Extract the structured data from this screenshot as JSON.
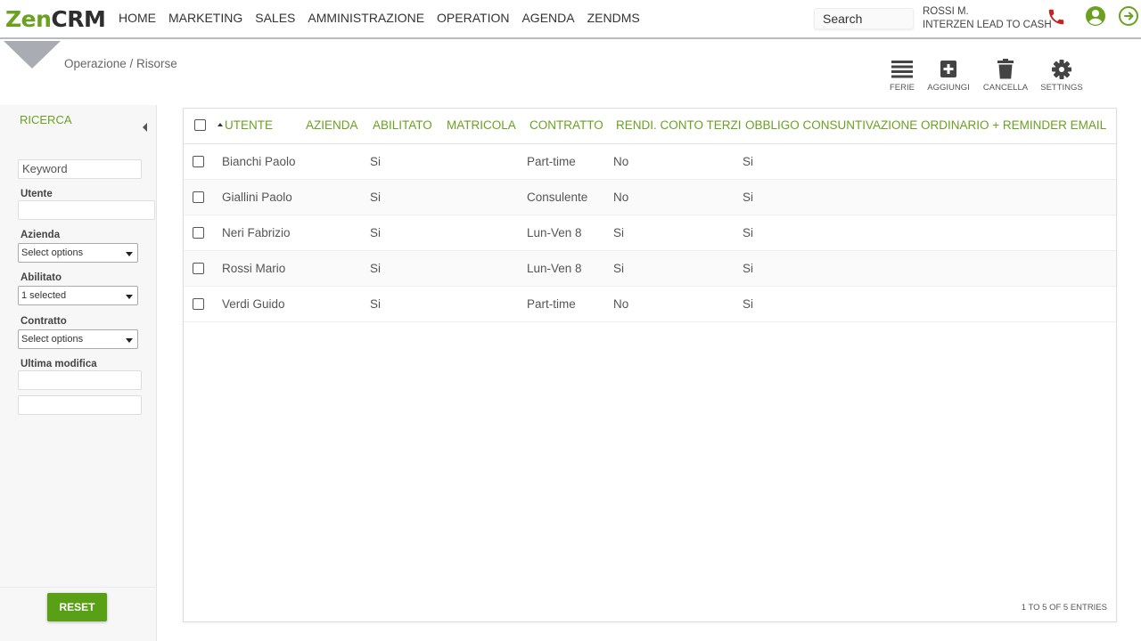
{
  "brand": {
    "part1": "Zen",
    "part2": "CRM"
  },
  "nav": [
    "HOME",
    "MARKETING",
    "SALES",
    "AMMINISTRAZIONE",
    "OPERATION",
    "AGENDA",
    "ZENDMS"
  ],
  "search": {
    "label": "Search"
  },
  "user": {
    "name": "ROSSI M.",
    "company": "INTERZEN LEAD TO CASH"
  },
  "icons": {
    "phone": "phone-icon",
    "user": "user-icon",
    "logout": "logout-icon"
  },
  "colors": {
    "accent": "#6aa121",
    "button": "#5aa016",
    "phone": "#c0261f"
  },
  "breadcrumb": "Operazione / Risorse",
  "toolbar": [
    {
      "label": "FERIE",
      "icon": "list-icon"
    },
    {
      "label": "AGGIUNGI",
      "icon": "plus-icon"
    },
    {
      "label": "CANCELLA",
      "icon": "trash-icon"
    },
    {
      "label": "SETTINGS",
      "icon": "gear-icon"
    }
  ],
  "sidebar": {
    "title": "RICERCA",
    "keyword_value": "Keyword",
    "fields": {
      "utente": "Utente",
      "azienda": "Azienda",
      "abilitato": "Abilitato",
      "contratto": "Contratto",
      "ultima_modifica": "Ultima modifica"
    },
    "azienda_value": "Select options",
    "abilitato_value": "1 selected",
    "contratto_value": "Select options",
    "reset_label": "RESET"
  },
  "table": {
    "columns": [
      "UTENTE",
      "AZIENDA",
      "ABILITATO",
      "MATRICOLA",
      "CONTRATTO",
      "RENDI. CONTO TERZI",
      "OBBLIGO CONSUNTIVAZIONE ORDINARIO + REMINDER EMAIL"
    ],
    "rows": [
      {
        "utente": "Bianchi Paolo",
        "abilitato": "Si",
        "contratto": "Part-time",
        "rendi": "No",
        "obbligo": "Si"
      },
      {
        "utente": "Giallini Paolo",
        "abilitato": "Si",
        "contratto": "Consulente",
        "rendi": "No",
        "obbligo": "Si"
      },
      {
        "utente": "Neri Fabrizio",
        "abilitato": "Si",
        "contratto": "Lun-Ven 8",
        "rendi": "Si",
        "obbligo": "Si"
      },
      {
        "utente": "Rossi Mario",
        "abilitato": "Si",
        "contratto": "Lun-Ven 8",
        "rendi": "Si",
        "obbligo": "Si"
      },
      {
        "utente": "Verdi Guido",
        "abilitato": "Si",
        "contratto": "Part-time",
        "rendi": "No",
        "obbligo": "Si"
      }
    ],
    "footer": "1 TO 5 OF 5 ENTRIES"
  }
}
